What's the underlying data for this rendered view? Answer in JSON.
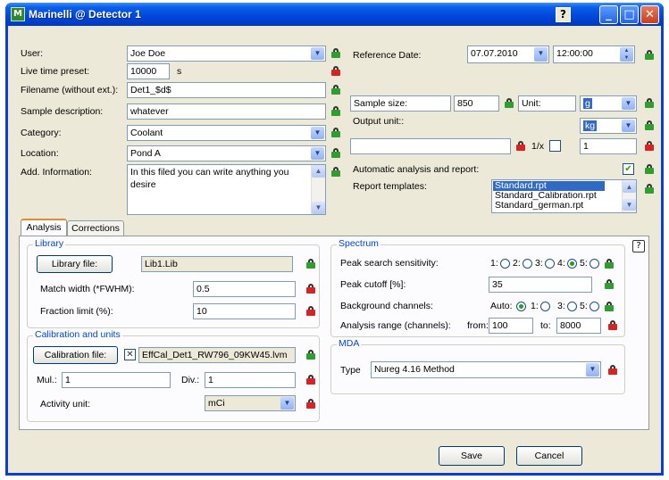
{
  "window": {
    "title": "Marinelli @ Detector 1",
    "help": "?",
    "min": "_",
    "max": "□",
    "close": "✕"
  },
  "form": {
    "user_label": "User:",
    "user_value": "Joe Doe",
    "live_time_label": "Live time preset:",
    "live_time_value": "10000",
    "live_time_unit": "s",
    "filename_label": "Filename (without ext.):",
    "filename_value": "Det1_$d$",
    "sample_desc_label": "Sample description:",
    "sample_desc_value": "whatever",
    "category_label": "Category:",
    "category_value": "Coolant",
    "location_label": "Location:",
    "location_value": "Pond A",
    "add_info_label": "Add. Information:",
    "add_info_value": "In this filed you can write anything you desire",
    "ref_date_label": "Reference Date:",
    "ref_date_value": "07.07.2010",
    "ref_time_value": "12:00:00",
    "sample_size_label": "Sample size:",
    "sample_size_value": "850",
    "unit_label": "Unit:",
    "unit_value": "g",
    "output_unit_label": "Output unit::",
    "output_unit_value": "kg",
    "inverse_label": "1/x",
    "factor_value": "1",
    "auto_analysis_label": "Automatic analysis and report:",
    "report_templates_label": "Report templates:",
    "report_templates": [
      "Standard.rpt",
      "Standard_Calibration.rpt",
      "Standard_german.rpt"
    ]
  },
  "tabs": [
    "Analysis",
    "Corrections"
  ],
  "analysis": {
    "library": {
      "title": "Library",
      "library_button": "Library file:",
      "library_value": "Lib1.Lib",
      "match_width_label": "Match width (*FWHM):",
      "match_width_value": "0.5",
      "fraction_limit_label": "Fraction limit (%):",
      "fraction_limit_value": "10"
    },
    "calibration": {
      "title": "Calibration and units",
      "calibration_button": "Calibration file:",
      "calibration_value": "EffCal_Det1_RW796_09KW45.lvm",
      "mul_label": "Mul.:",
      "mul_value": "1",
      "div_label": "Div.:",
      "div_value": "1",
      "activity_unit_label": "Activity unit:",
      "activity_unit_value": "mCi"
    },
    "spectrum": {
      "title": "Spectrum",
      "peak_sensitivity_label": "Peak search sensitivity:",
      "sensitivity_options": [
        "1:",
        "2:",
        "3:",
        "4:",
        "5:"
      ],
      "sensitivity_selected": "4:",
      "peak_cutoff_label": "Peak cutoff [%]:",
      "peak_cutoff_value": "35",
      "background_label": "Background channels:",
      "background_options": [
        "Auto:",
        "1:",
        "3:",
        "5:"
      ],
      "background_selected": "Auto:",
      "range_label": "Analysis range (channels):",
      "from_label": "from:",
      "from_value": "100",
      "to_label": "to:",
      "to_value": "8000"
    },
    "mda": {
      "title": "MDA",
      "type_label": "Type",
      "type_value": "Nureg 4.16 Method"
    },
    "help": "?"
  },
  "buttons": {
    "save": "Save",
    "cancel": "Cancel"
  }
}
